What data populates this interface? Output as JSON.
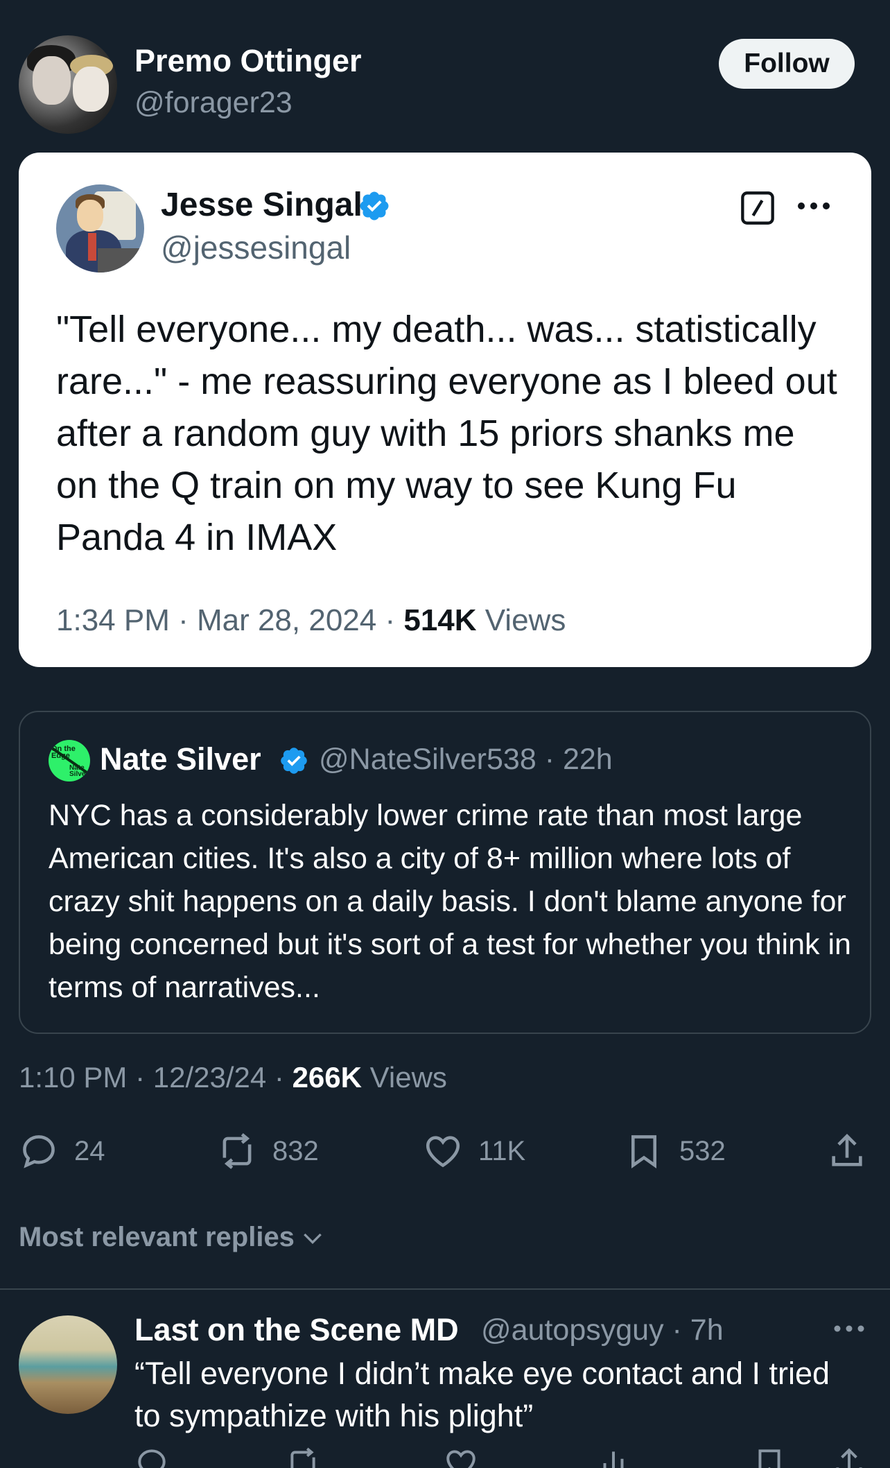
{
  "author": {
    "name": "Premo Ottinger",
    "handle": "@forager23",
    "follow_label": "Follow"
  },
  "embedded_post": {
    "name": "Jesse Singal",
    "handle": "@jessesingal",
    "verified": true,
    "text": "\"Tell everyone... my death... was... statistically rare...\" - me reassuring everyone as I bleed out after a random guy with 15 priors shanks me on the Q train on my way to see Kung Fu Panda 4 in IMAX",
    "time": "1:34 PM · Mar 28, 2024 · ",
    "views_count": "514K",
    "views_label": " Views"
  },
  "quoted_post": {
    "name": "Nate Silver",
    "verified": true,
    "handle": "@NateSilver538 · 22h",
    "avatar_text_1": "On the Edge",
    "avatar_text_2": "Nate Silver",
    "text": "NYC has a considerably lower crime rate than most large American cities. It's also a city of 8+ million where lots of crazy shit happens on a daily basis. I don't blame anyone for being concerned but it's sort of a test for whether you think in terms of narratives..."
  },
  "meta": {
    "time": "1:10 PM · 12/23/24 · ",
    "views_count": "266K",
    "views_label": " Views"
  },
  "actions": {
    "replies": "24",
    "reposts": "832",
    "likes": "11K",
    "bookmarks": "532"
  },
  "replies_sort_label": "Most relevant replies",
  "reply": {
    "name": "Last on the Scene MD",
    "handle": "@autopsyguy · 7h",
    "text": "“Tell everyone I didn’t make eye contact and I tried to sympathize with his plight”"
  },
  "colors": {
    "background": "#15202b",
    "verified_blue": "#1d9bf0",
    "muted_text": "#8b98a5",
    "border": "#38444d"
  }
}
